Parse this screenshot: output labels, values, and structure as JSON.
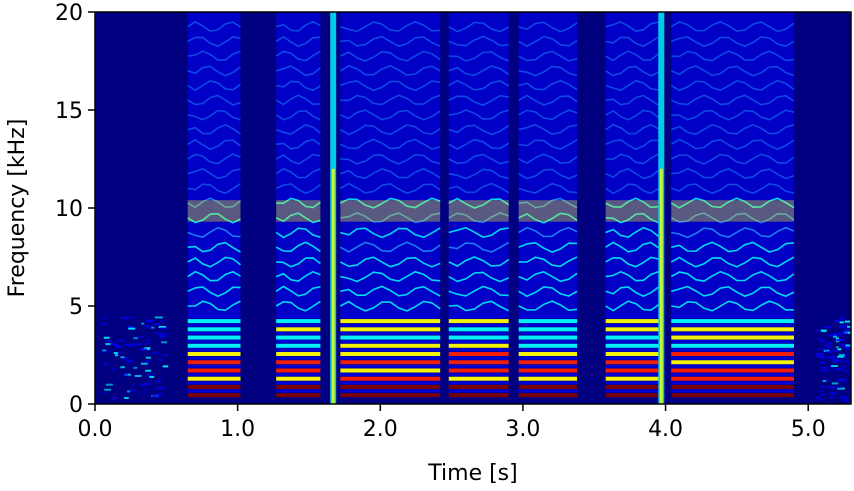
{
  "chart_data": {
    "type": "heatmap",
    "title": "",
    "xlabel": "Time [s]",
    "ylabel": "Frequency [kHz]",
    "xlim": [
      0,
      5.3
    ],
    "ylim": [
      0,
      20
    ],
    "xticks": [
      0.0,
      1.0,
      2.0,
      3.0,
      4.0,
      5.0
    ],
    "xtick_labels": [
      "0.0",
      "1.0",
      "2.0",
      "3.0",
      "4.0",
      "5.0"
    ],
    "yticks": [
      0,
      5,
      10,
      15,
      20
    ],
    "ytick_labels": [
      "0",
      "5",
      "10",
      "15",
      "20"
    ],
    "colormap": "jet",
    "colors": {
      "background": "#000080",
      "low": "#0000ff",
      "mid": "#00ffff",
      "high": "#ffff00",
      "peak": "#800000"
    },
    "voiced_segments_s": [
      {
        "start": 0.65,
        "end": 1.02
      },
      {
        "start": 1.27,
        "end": 1.58
      },
      {
        "start": 1.72,
        "end": 2.42
      },
      {
        "start": 2.48,
        "end": 2.9
      },
      {
        "start": 2.97,
        "end": 3.38
      },
      {
        "start": 3.58,
        "end": 3.95
      },
      {
        "start": 4.04,
        "end": 4.9
      }
    ],
    "broadband_events_s": [
      1.67,
      3.97
    ],
    "noise_segments_s": [
      {
        "start": 0.05,
        "end": 0.48
      },
      {
        "start": 5.05,
        "end": 5.28
      }
    ]
  }
}
